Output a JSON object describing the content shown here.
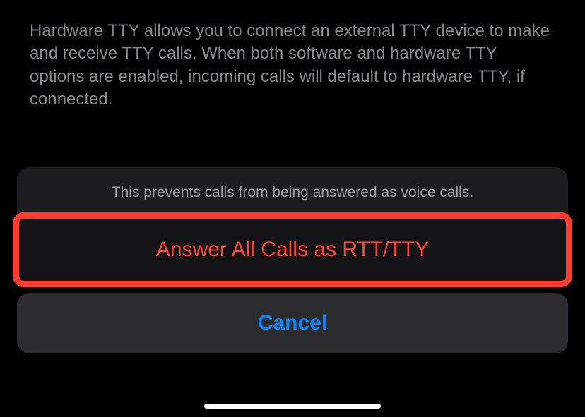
{
  "settings": {
    "hardware_tty_description": "Hardware TTY allows you to connect an external TTY device to make and receive TTY calls. When both software and hardware TTY options are enabled, incoming calls will default to hardware TTY, if connected."
  },
  "action_sheet": {
    "message": "This prevents calls from being answered as voice calls.",
    "destructive_action_label": "Answer All Calls as RTT/TTY",
    "cancel_label": "Cancel"
  }
}
